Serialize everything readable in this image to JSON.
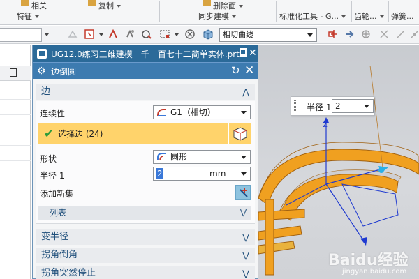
{
  "ribbon": {
    "top_items": [
      "相关",
      "复制",
      "删除面"
    ],
    "groups": [
      "特征",
      "同步建模",
      "标准化工具 - G...",
      "齿轮...",
      "弹簧..."
    ]
  },
  "toolbar": {
    "curve_rule": "相切曲线"
  },
  "dialog": {
    "window_title": "UG12.0练习三维建模一千一百七十二简单实体.prt",
    "title": "边倒圆",
    "sections": {
      "edge": {
        "header": "边",
        "continuity_label": "连续性",
        "continuity_value": "G1（相切）",
        "select_edge_label": "选择边 (24)",
        "shape_label": "形状",
        "shape_value": "圆形",
        "radius_label": "半径 1",
        "radius_value": "2",
        "radius_unit": "mm",
        "add_set_label": "添加新集",
        "list_label": "列表"
      },
      "variable_radius": "变半径",
      "corner_setback": "拐角倒角",
      "corner_stop": "拐角突然停止"
    }
  },
  "graphics": {
    "radius_tip_label": "半径 1",
    "radius_tip_value": "2",
    "watermark": "Baidu经验",
    "watermark_sub": "jingyan.baidu.com"
  },
  "colors": {
    "title_bar": "#2b6a99",
    "sub_bar": "#3d7bb0",
    "select_highlight": "#ffd36b",
    "section_text": "#1e4e7a",
    "model_orange": "#f0a020"
  }
}
